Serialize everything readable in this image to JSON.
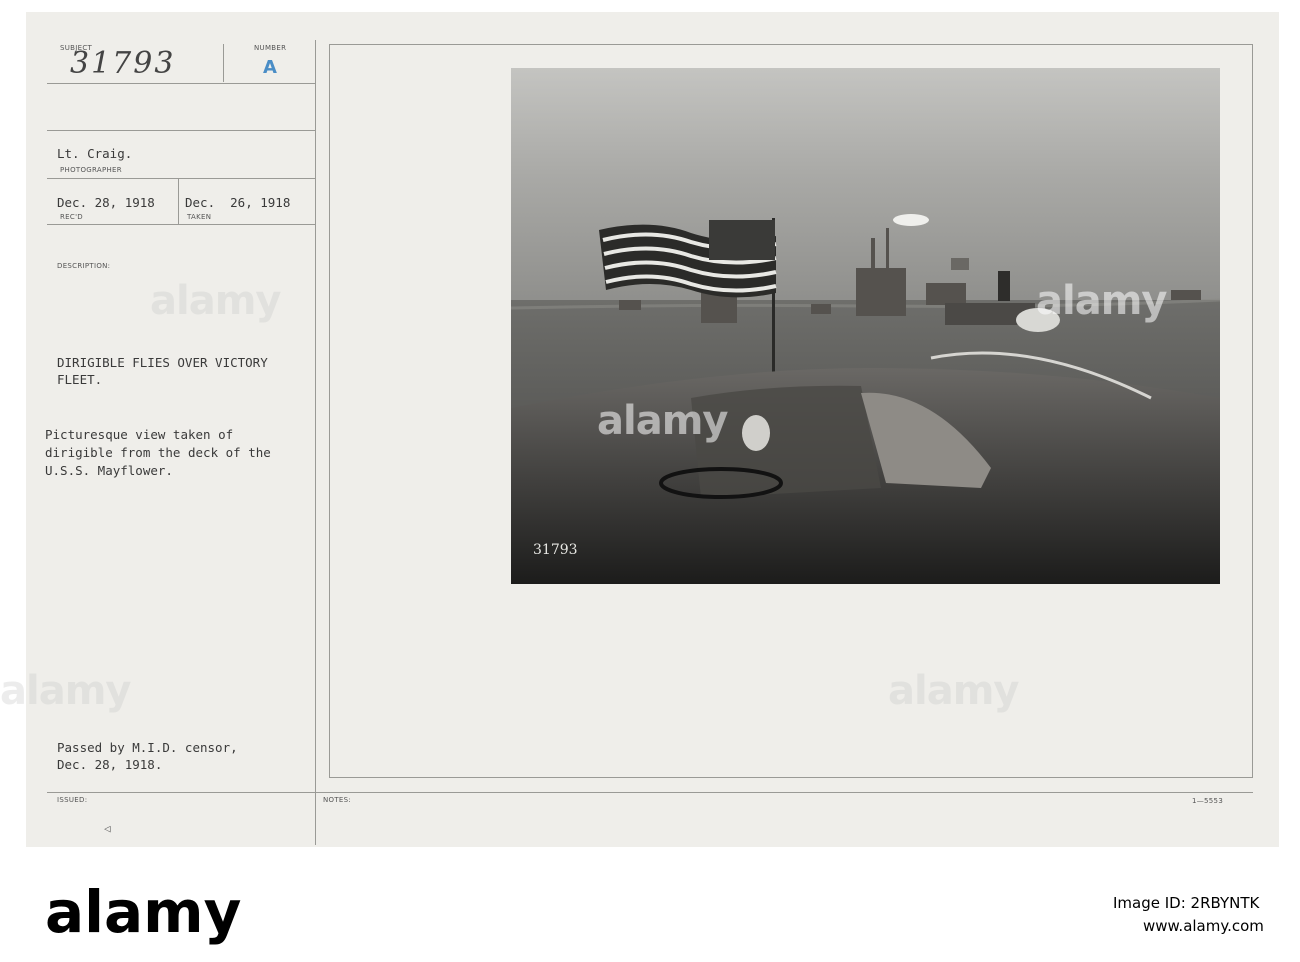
{
  "card": {
    "subject_label": "SUBJECT",
    "subject_number": "31793",
    "number_label": "NUMBER",
    "number_stamp": "A",
    "photographer_name": "Lt. Craig.",
    "photographer_label": "PHOTOGRAPHER",
    "received_date": "Dec. 28, 1918",
    "received_label": "REC'D",
    "taken_date": "Dec.  26, 1918",
    "taken_label": "TAKEN",
    "description_label": "DESCRIPTION:",
    "headline_line1": "DIRIGIBLE FLIES OVER VICTORY",
    "headline_line2": "FLEET.",
    "description_line1": "Picturesque view taken of",
    "description_line2": "dirigible from the deck of the",
    "description_line3": "U.S.S. Mayflower.",
    "censor_line1": "Passed by M.I.D. censor,",
    "censor_line2": "Dec. 28, 1918.",
    "issued_label": "ISSUED:",
    "notes_label": "NOTES:",
    "form_code": "1—5553",
    "photo_inscription": "31793"
  },
  "watermark": "alamy",
  "footer": {
    "logo": "alamy",
    "image_id_label": "Image ID: 2RBYNTK",
    "url": "www.alamy.com"
  },
  "colors": {
    "card": "#efeeea",
    "stamp": "#4a8dc6"
  }
}
